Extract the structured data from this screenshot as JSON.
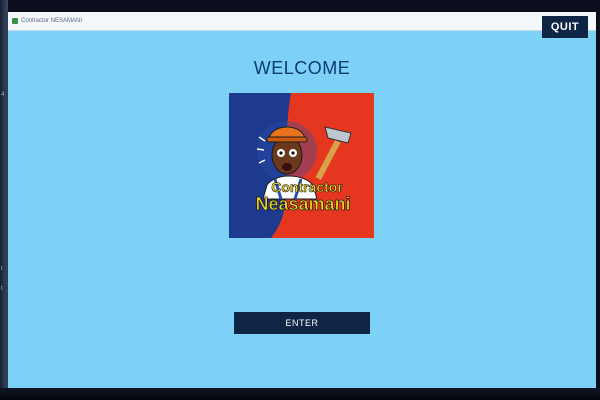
{
  "window": {
    "title": "Contractor NESAMANI",
    "close_glyph": "×"
  },
  "toolbar": {
    "quit_label": "QUIT"
  },
  "main": {
    "heading": "WELCOME",
    "logo": {
      "line1": "Contractor",
      "line2": "Neasamani"
    },
    "enter_label": "ENTER"
  },
  "icons": {
    "app": "app-icon",
    "close": "close-icon",
    "logo": "hammer-character-logo"
  },
  "colors": {
    "background": "#7dd0f6",
    "button": "#0e2546",
    "heading": "#0a3b76",
    "logo_left": "#1d3a8f",
    "logo_right": "#e5371f",
    "logo_text": "#f3d81b"
  }
}
